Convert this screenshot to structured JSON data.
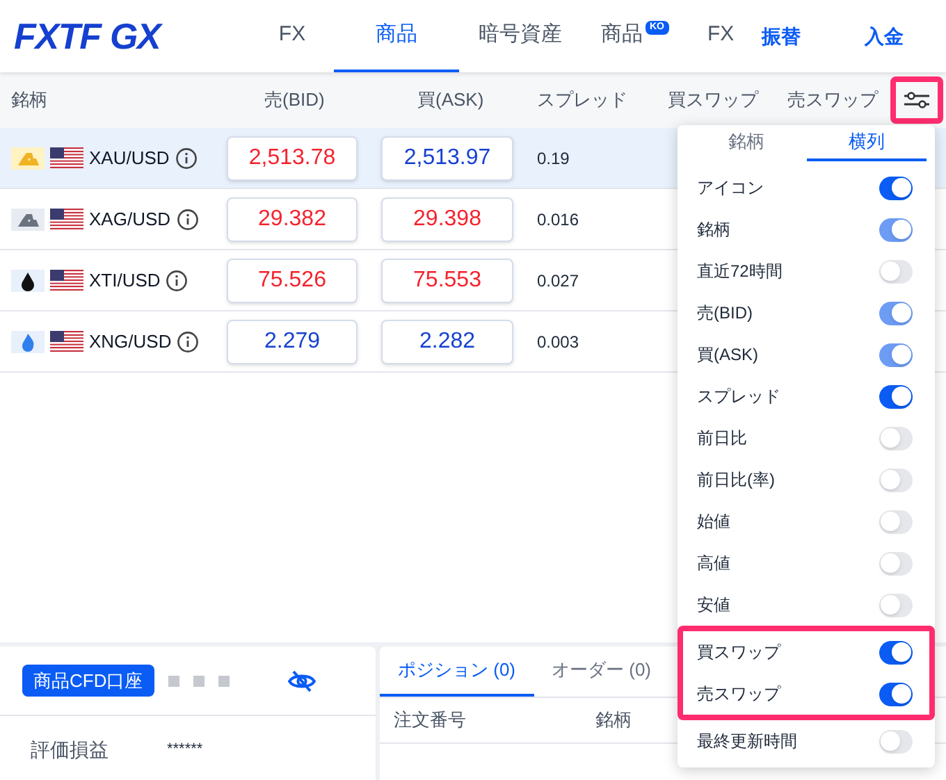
{
  "nav": {
    "logo": "FXTF GX",
    "tabs": [
      {
        "label": "FX",
        "selected": false
      },
      {
        "label": "商品",
        "selected": true
      },
      {
        "label": "暗号資産",
        "selected": false
      },
      {
        "label": "商品",
        "badge": "KO",
        "selected": false
      },
      {
        "label": "FX",
        "selected": false
      }
    ],
    "links": [
      "振替",
      "入金"
    ]
  },
  "table": {
    "columns": [
      "銘柄",
      "売(BID)",
      "買(ASK)",
      "スプレッド",
      "買スワップ",
      "売スワップ"
    ],
    "settings_highlighted": true,
    "rows": [
      {
        "kind": "gold",
        "symbol": "XAU/USD",
        "bid": {
          "value": "2,513.78",
          "color": "#f5222d"
        },
        "ask": {
          "value": "2,513.97",
          "color": "#1540d0"
        },
        "spread": "0.19",
        "selected": true
      },
      {
        "kind": "silver",
        "symbol": "XAG/USD",
        "bid": {
          "value": "29.382",
          "color": "#f5222d"
        },
        "ask": {
          "value": "29.398",
          "color": "#f5222d"
        },
        "spread": "0.016",
        "selected": false
      },
      {
        "kind": "oil",
        "symbol": "XTI/USD",
        "bid": {
          "value": "75.526",
          "color": "#f5222d"
        },
        "ask": {
          "value": "75.553",
          "color": "#f5222d"
        },
        "spread": "0.027",
        "selected": false
      },
      {
        "kind": "gas",
        "symbol": "XNG/USD",
        "bid": {
          "value": "2.279",
          "color": "#1540d0"
        },
        "ask": {
          "value": "2.282",
          "color": "#1540d0"
        },
        "spread": "0.003",
        "selected": false
      }
    ]
  },
  "column_settings": {
    "tabs": [
      {
        "label": "銘柄",
        "selected": false
      },
      {
        "label": "横列",
        "selected": true
      }
    ],
    "items": [
      {
        "label": "アイコン",
        "on": true,
        "disabled": false,
        "highlighted": false
      },
      {
        "label": "銘柄",
        "on": true,
        "disabled": true,
        "highlighted": false
      },
      {
        "label": "直近72時間",
        "on": false,
        "disabled": false,
        "highlighted": false
      },
      {
        "label": "売(BID)",
        "on": true,
        "disabled": true,
        "highlighted": false
      },
      {
        "label": "買(ASK)",
        "on": true,
        "disabled": true,
        "highlighted": false
      },
      {
        "label": "スプレッド",
        "on": true,
        "disabled": false,
        "highlighted": false
      },
      {
        "label": "前日比",
        "on": false,
        "disabled": false,
        "highlighted": false
      },
      {
        "label": "前日比(率)",
        "on": false,
        "disabled": false,
        "highlighted": false
      },
      {
        "label": "始値",
        "on": false,
        "disabled": false,
        "highlighted": false
      },
      {
        "label": "高値",
        "on": false,
        "disabled": false,
        "highlighted": false
      },
      {
        "label": "安値",
        "on": false,
        "disabled": false,
        "highlighted": false
      },
      {
        "label": "買スワップ",
        "on": true,
        "disabled": false,
        "highlighted": true
      },
      {
        "label": "売スワップ",
        "on": true,
        "disabled": false,
        "highlighted": true
      },
      {
        "label": "最終更新時間",
        "on": false,
        "disabled": false,
        "highlighted": false
      }
    ]
  },
  "account": {
    "button": "商品CFD口座",
    "rows": [
      {
        "label": "評価損益",
        "value": "******"
      }
    ]
  },
  "positions": {
    "tabs": [
      {
        "label": "ポジション (0)",
        "selected": true
      },
      {
        "label": "オーダー (0)",
        "selected": false
      }
    ],
    "columns": [
      "注文番号",
      "銘柄"
    ]
  }
}
